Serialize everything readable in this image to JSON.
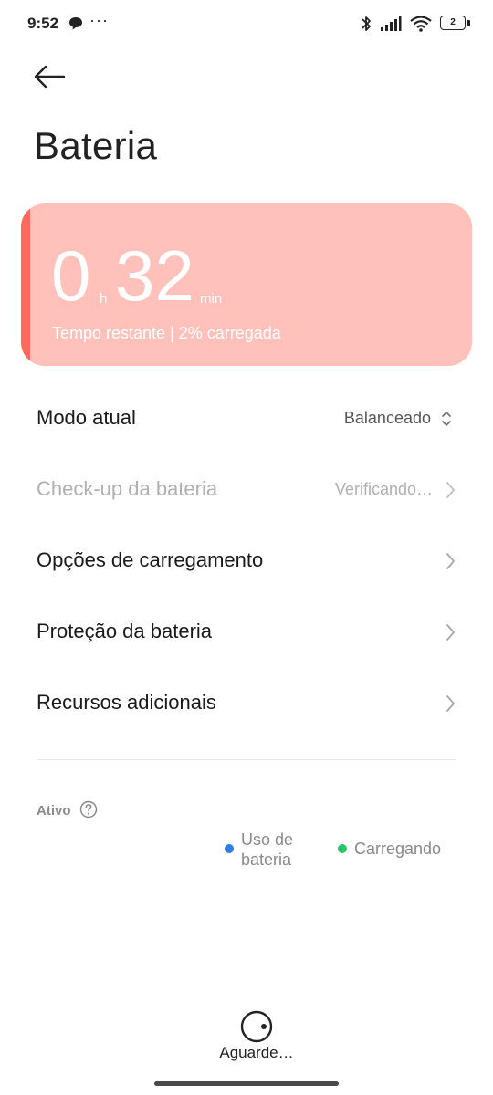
{
  "status_bar": {
    "time": "9:52",
    "dots": "···",
    "battery_level": "2",
    "icons": [
      "chat-bubble-icon",
      "bluetooth-icon",
      "signal-icon",
      "wifi-icon",
      "battery-icon"
    ]
  },
  "header": {
    "title": "Bateria",
    "back_icon": "arrow-left-icon"
  },
  "battery_card": {
    "hours": "0",
    "hours_unit": "h",
    "minutes": "32",
    "minutes_unit": "min",
    "status_text": "Tempo restante | 2% carregada",
    "background_color": "#ffc1ba",
    "accent_color": "#ff6a5c"
  },
  "settings": {
    "items": [
      {
        "label": "Modo atual",
        "value": "Balanceado",
        "icon": "up-down-chevron-icon",
        "enabled": true
      },
      {
        "label": "Check-up da bateria",
        "value": "Verificando…",
        "icon": "chevron-right-icon",
        "enabled": false
      },
      {
        "label": "Opções de carregamento",
        "value": "",
        "icon": "chevron-right-icon",
        "enabled": true
      },
      {
        "label": "Proteção da bateria",
        "value": "",
        "icon": "chevron-right-icon",
        "enabled": true
      },
      {
        "label": "Recursos adicionais",
        "value": "",
        "icon": "chevron-right-icon",
        "enabled": true
      }
    ]
  },
  "active_section": {
    "label": "Ativo",
    "help_icon": "question-circle-icon",
    "legend": [
      {
        "label": "Uso de bateria",
        "color": "#2f7be5"
      },
      {
        "label": "Carregando",
        "color": "#2fc266"
      }
    ]
  },
  "loading": {
    "text": "Aguarde…",
    "icon": "loading-spinner-icon"
  }
}
